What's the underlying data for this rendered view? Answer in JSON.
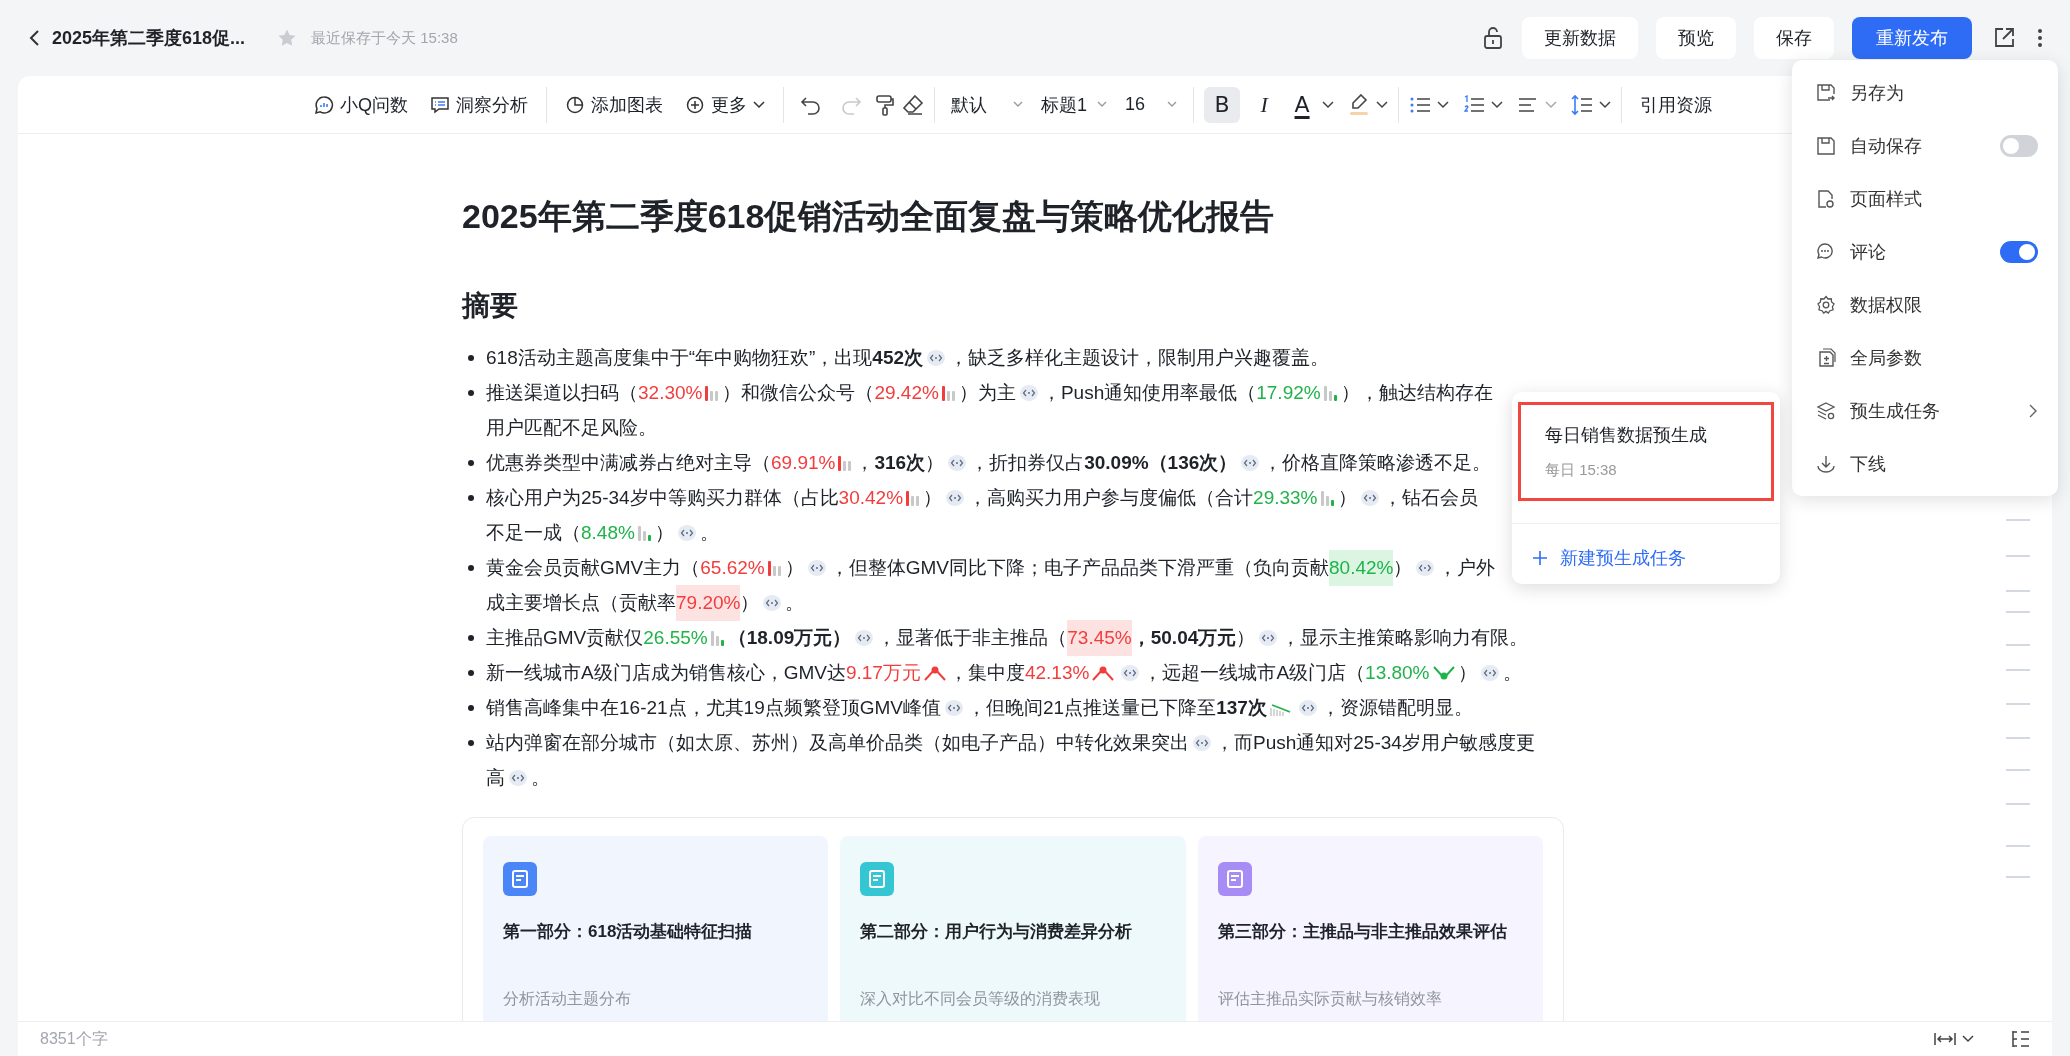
{
  "header": {
    "title": "2025年第二季度618促...",
    "starred": false,
    "saved_at": "最近保存于今天 15:38",
    "buttons": [
      {
        "label": "更新数据",
        "kind": "default"
      },
      {
        "label": "预览",
        "kind": "default"
      },
      {
        "label": "保存",
        "kind": "default"
      },
      {
        "label": "重新发布",
        "kind": "primary"
      }
    ]
  },
  "toolbar": {
    "actions": [
      {
        "label": "小Q问数"
      },
      {
        "label": "洞察分析"
      },
      {
        "label": "添加图表"
      },
      {
        "label": "更多"
      }
    ],
    "history": [
      {
        "kind": "undo",
        "disabled": false
      },
      {
        "kind": "redo",
        "disabled": true
      }
    ],
    "selects": [
      {
        "value": "默认"
      },
      {
        "value": "标题1"
      },
      {
        "value": "16"
      }
    ],
    "format": [
      {
        "label": "B",
        "selected": true
      },
      {
        "label": "I",
        "selected": false
      }
    ],
    "font_color": {
      "label": "A"
    },
    "cite": {
      "label": "引用资源"
    }
  },
  "document": {
    "title": "2025年第二季度618促销活动全面复盘与策略优化报告",
    "heading": "摘要",
    "bullets": [
      {
        "lines": [
          [
            {
              "kind": "t",
              "text": "618活动主题高度集中于“年中购物狂欢”，出现"
            },
            {
              "kind": "b",
              "text": "452次"
            },
            {
              "kind": "ref"
            },
            {
              "kind": "t",
              "text": "，缺乏多样化主题设计，限制用户兴趣覆盖。"
            }
          ]
        ]
      },
      {
        "lines": [
          [
            {
              "kind": "t",
              "text": "推送渠道以扫码（"
            },
            {
              "kind": "red-bars",
              "text": "32.30%"
            },
            {
              "kind": "t",
              "text": "）和微信公众号（"
            },
            {
              "kind": "red-bars",
              "text": "29.42%"
            },
            {
              "kind": "t",
              "text": "）为主"
            },
            {
              "kind": "ref"
            },
            {
              "kind": "t",
              "text": "，Push通知使用率最低（"
            },
            {
              "kind": "green-bars",
              "text": "17.92%"
            },
            {
              "kind": "t",
              "text": "），触达结构存在"
            }
          ],
          [
            {
              "kind": "t",
              "text": "用户匹配不足风险。"
            }
          ]
        ]
      },
      {
        "lines": [
          [
            {
              "kind": "t",
              "text": "优惠券类型中满减券占绝对主导（"
            },
            {
              "kind": "red-bars",
              "text": "69.91%"
            },
            {
              "kind": "t",
              "text": "，"
            },
            {
              "kind": "b",
              "text": "316次"
            },
            {
              "kind": "t",
              "text": "）"
            },
            {
              "kind": "ref"
            },
            {
              "kind": "t",
              "text": "，折扣券仅占"
            },
            {
              "kind": "b",
              "text": "30.09%（136次）"
            },
            {
              "kind": "ref"
            },
            {
              "kind": "t",
              "text": "，价格直降策略渗透不足。"
            }
          ]
        ]
      },
      {
        "lines": [
          [
            {
              "kind": "t",
              "text": "核心用户为25-34岁中等购买力群体（占比"
            },
            {
              "kind": "red-bars",
              "text": "30.42%"
            },
            {
              "kind": "t",
              "text": "）"
            },
            {
              "kind": "ref"
            },
            {
              "kind": "t",
              "text": "，高购买力用户参与度偏低（合计"
            },
            {
              "kind": "green-bars",
              "text": "29.33%"
            },
            {
              "kind": "t",
              "text": "）"
            },
            {
              "kind": "ref"
            },
            {
              "kind": "t",
              "text": "，钻石会员"
            }
          ],
          [
            {
              "kind": "t",
              "text": "不足一成（"
            },
            {
              "kind": "green-bars",
              "text": "8.48%"
            },
            {
              "kind": "t",
              "text": "）"
            },
            {
              "kind": "ref"
            },
            {
              "kind": "t",
              "text": "。"
            }
          ]
        ]
      },
      {
        "lines": [
          [
            {
              "kind": "t",
              "text": "黄金会员贡献GMV主力（"
            },
            {
              "kind": "red-bars",
              "text": "65.62%"
            },
            {
              "kind": "t",
              "text": "）"
            },
            {
              "kind": "ref"
            },
            {
              "kind": "t",
              "text": "，但整体GMV同比下降；电子产品品类下滑严重（负向贡献"
            },
            {
              "kind": "green-hl",
              "text": "80.42%"
            },
            {
              "kind": "t",
              "text": "）"
            },
            {
              "kind": "ref"
            },
            {
              "kind": "t",
              "text": "，户外"
            }
          ],
          [
            {
              "kind": "t",
              "text": "成主要增长点（贡献率"
            },
            {
              "kind": "red-hl",
              "text": "79.20%"
            },
            {
              "kind": "t",
              "text": "）"
            },
            {
              "kind": "ref"
            },
            {
              "kind": "t",
              "text": "。"
            }
          ]
        ]
      },
      {
        "lines": [
          [
            {
              "kind": "t",
              "text": "主推品GMV贡献仅"
            },
            {
              "kind": "green-bars",
              "text": "26.55%"
            },
            {
              "kind": "b",
              "text": "（18.09万元）"
            },
            {
              "kind": "ref"
            },
            {
              "kind": "t",
              "text": "，显著低于非主推品（"
            },
            {
              "kind": "red-hl",
              "text": "73.45%"
            },
            {
              "kind": "b",
              "text": "，50.04万元"
            },
            {
              "kind": "t",
              "text": "）"
            },
            {
              "kind": "ref"
            },
            {
              "kind": "t",
              "text": "，显示主推策略影响力有限。"
            }
          ]
        ]
      },
      {
        "lines": [
          [
            {
              "kind": "t",
              "text": "新一线城市A级门店成为销售核心，GMV达"
            },
            {
              "kind": "red-peak",
              "text": "9.17万元"
            },
            {
              "kind": "t",
              "text": "，集中度"
            },
            {
              "kind": "red-peak",
              "text": "42.13%"
            },
            {
              "kind": "ref"
            },
            {
              "kind": "t",
              "text": "，远超一线城市A级门店（"
            },
            {
              "kind": "green-dip",
              "text": "13.80%"
            },
            {
              "kind": "t",
              "text": "）"
            },
            {
              "kind": "ref"
            },
            {
              "kind": "t",
              "text": "。"
            }
          ]
        ]
      },
      {
        "lines": [
          [
            {
              "kind": "t",
              "text": "销售高峰集中在16-21点，尤其19点频繁登顶GMV峰值"
            },
            {
              "kind": "ref"
            },
            {
              "kind": "t",
              "text": "，但晚间21点推送量已下降至"
            },
            {
              "kind": "bold-trend",
              "text": "137次"
            },
            {
              "kind": "ref"
            },
            {
              "kind": "t",
              "text": "，资源错配明显。"
            }
          ]
        ]
      },
      {
        "lines": [
          [
            {
              "kind": "t",
              "text": "站内弹窗在部分城市（如太原、苏州）及高单价品类（如电子产品）中转化效果突出"
            },
            {
              "kind": "ref"
            },
            {
              "kind": "t",
              "text": "，而Push通知对25-34岁用户敏感度更"
            }
          ],
          [
            {
              "kind": "t",
              "text": "高"
            },
            {
              "kind": "ref"
            },
            {
              "kind": "t",
              "text": "。"
            }
          ]
        ]
      }
    ],
    "sections": [
      {
        "title": "第一部分：618活动基础特征扫描",
        "subtitle": "分析活动主题分布",
        "color": "#4a86f7"
      },
      {
        "title": "第二部分：用户行为与消费差异分析",
        "subtitle": "深入对比不同会员等级的消费表现",
        "color": "#35c6d3"
      },
      {
        "title": "第三部分：主推品与非主推品效果评估",
        "subtitle": "评估主推品实际贡献与核销效率",
        "color": "#a68cf4"
      }
    ]
  },
  "status_bar": {
    "word_count": "8351个字"
  },
  "menu": {
    "items": [
      {
        "label": "另存为",
        "kind": "action"
      },
      {
        "label": "自动保存",
        "kind": "toggle",
        "on": false
      },
      {
        "label": "页面样式",
        "kind": "action"
      },
      {
        "label": "评论",
        "kind": "toggle",
        "on": true
      },
      {
        "label": "数据权限",
        "kind": "action"
      },
      {
        "label": "全局参数",
        "kind": "action"
      },
      {
        "label": "预生成任务",
        "kind": "submenu"
      },
      {
        "label": "下线",
        "kind": "action"
      }
    ]
  },
  "submenu": {
    "tasks": [
      {
        "title": "每日销售数据预生成",
        "time": "每日 15:38",
        "selected": true
      }
    ],
    "new_label": "新建预生成任务"
  }
}
